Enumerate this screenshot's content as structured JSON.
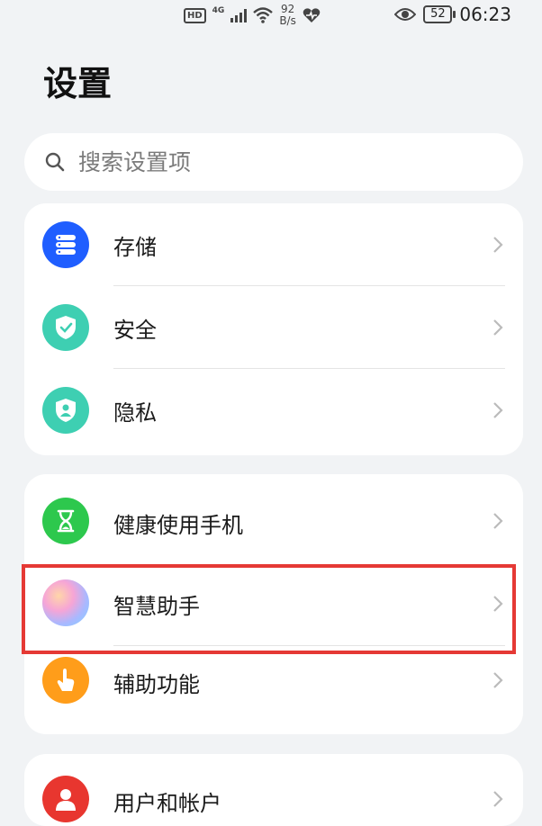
{
  "status_bar": {
    "hd": "HD",
    "network": "4G",
    "speed_value": "92",
    "speed_unit": "B/s",
    "battery": "52",
    "time": "06:23"
  },
  "page_title": "设置",
  "search": {
    "placeholder": "搜索设置项"
  },
  "groups": [
    {
      "items": [
        {
          "label": "存储",
          "icon": "storage-icon",
          "color": "#1f5eff"
        },
        {
          "label": "安全",
          "icon": "security-shield-icon",
          "color": "#3ecfb2"
        },
        {
          "label": "隐私",
          "icon": "privacy-shield-icon",
          "color": "#3ecfb2"
        }
      ]
    },
    {
      "items": [
        {
          "label": "健康使用手机",
          "icon": "hourglass-icon",
          "color": "#2dc84d"
        },
        {
          "label": "智慧助手",
          "icon": "assistant-orb-icon",
          "color": "#c9a6ff"
        },
        {
          "label": "辅助功能",
          "icon": "hand-pointer-icon",
          "color": "#ff9d1a"
        }
      ]
    },
    {
      "items": [
        {
          "label": "用户和帐户",
          "icon": "user-icon",
          "color": "#e8362f"
        }
      ]
    }
  ],
  "highlight": {
    "target": "智慧助手",
    "color": "#e53935"
  }
}
